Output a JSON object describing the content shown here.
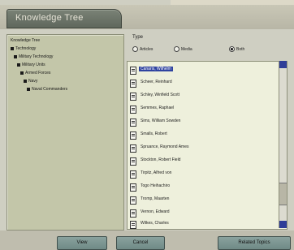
{
  "window": {
    "title": "Knowledge Tree"
  },
  "tree": {
    "items": [
      "Knowledge Tree",
      "Technology",
      "Military Technology",
      "Military Units",
      "Armed Forces",
      "Navy",
      "Naval Commanders"
    ]
  },
  "types": {
    "label": "Type",
    "options": [
      {
        "label": "Articles",
        "selected": false
      },
      {
        "label": "Media",
        "selected": false
      },
      {
        "label": "Both",
        "selected": true
      }
    ]
  },
  "list": {
    "items": [
      "Canaris, Wilhelm",
      "Scheer, Reinhard",
      "Schley, Winfield Scott",
      "Semmes, Raphael",
      "Sims, William Sowden",
      "Smalls, Robert",
      "Spruance, Raymond Ames",
      "Stockton, Robert Field",
      "Tirpitz, Alfred von",
      "Togo Heihachiro",
      "Tromp, Maarten",
      "Vernon, Edward",
      "Wilkes, Charles"
    ],
    "selected_index": 0
  },
  "buttons": {
    "view": "View",
    "cancel": "Cancel",
    "related": "Related Topics"
  },
  "colors": {
    "selection": "#2f43a0",
    "panel": "#c3c6a9",
    "button": "#7f9894"
  }
}
